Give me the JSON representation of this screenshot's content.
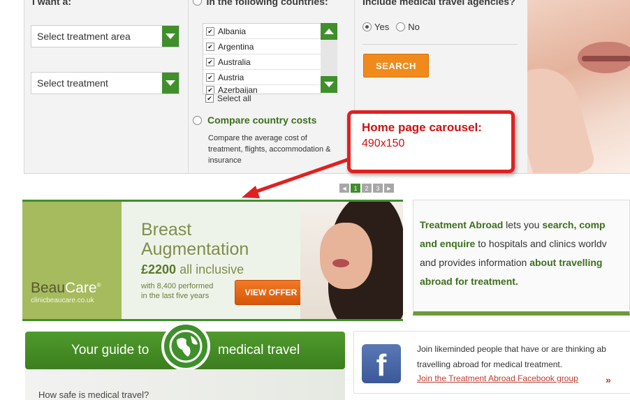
{
  "search": {
    "want_heading": "I want a:",
    "countries_heading": "In the following countries:",
    "agencies_heading": "Include medical travel agencies?",
    "treatment_area": "Select treatment area",
    "treatment": "Select treatment",
    "countries": [
      "Albania",
      "Argentina",
      "Australia",
      "Austria",
      "Azerbaijan"
    ],
    "select_all": "Select all",
    "yes": "Yes",
    "no": "No",
    "search_button": "SEARCH",
    "compare_title": "Compare country costs",
    "compare_desc_1": "Compare the average cost of",
    "compare_desc_2": "treatment, flights, accommodation &",
    "compare_desc_3": "insurance"
  },
  "callout": {
    "title": "Home page carousel:",
    "size": "490x150"
  },
  "pager": {
    "prev": "◄",
    "pages": [
      "1",
      "2",
      "3"
    ],
    "next": "►",
    "active_page": 1
  },
  "carousel": {
    "brand_a": "Beau",
    "brand_b": "Care",
    "brand_mark": "®",
    "brand_url": "clinicbeaucare.co.uk",
    "title_1": "Breast",
    "title_2": "Augmentation",
    "price": "£2200",
    "price_suffix": "all inclusive",
    "performed_1": "with 8,400 performed",
    "performed_2": "in the last five years",
    "offer_button": "VIEW OFFER"
  },
  "info": {
    "l1_g": "Treatment Abroad",
    "l1_t": " lets you ",
    "l1_g2": "search, comp",
    "l2_g": "and enquire",
    "l2_t": " to hospitals and clinics worldv",
    "l3_t": "and provides information ",
    "l3_g": "about travelling",
    "l4_g": "abroad for treatment."
  },
  "guide": {
    "left": "Your guide to",
    "right": "medical travel",
    "question": "How safe is medical travel?"
  },
  "facebook": {
    "line1": "Join likeminded people that have or are thinking ab",
    "line2": "travelling abroad for medical treatment.",
    "link": "Join the Treatment Abroad Facebook group",
    "arrow": "»",
    "logo": "f"
  },
  "colors": {
    "accent_green": "#3f8f2b",
    "orange": "#f08a1c",
    "callout_red": "#e02020"
  }
}
